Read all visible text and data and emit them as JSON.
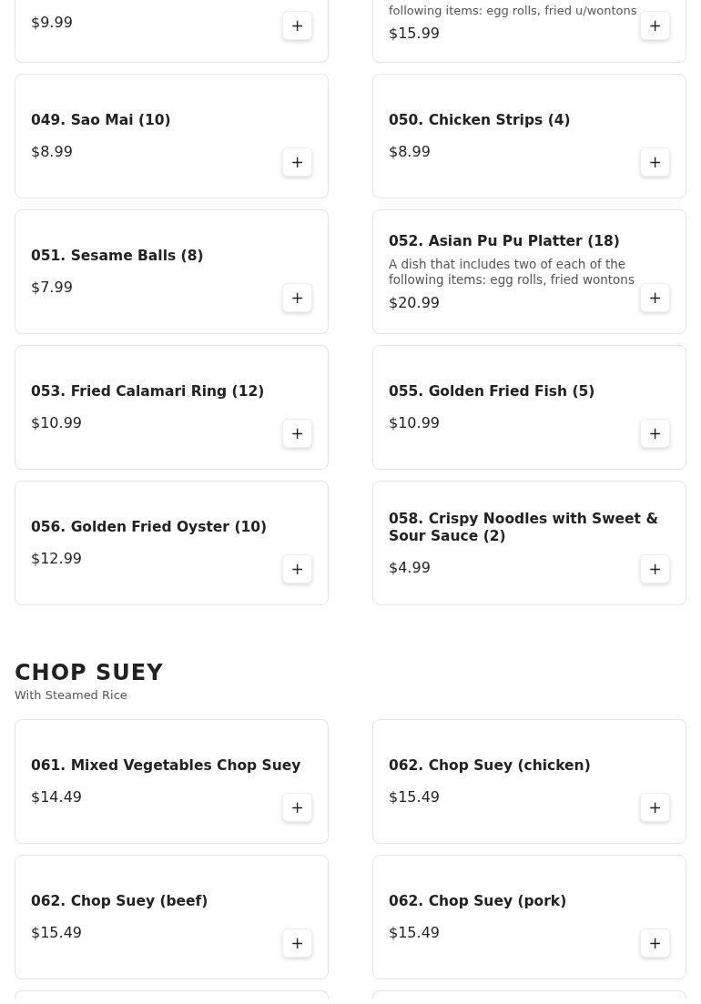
{
  "sections": [
    {
      "rows": [
        {
          "items": [
            {
              "kind": "cut-top",
              "price": "$9.99",
              "add_label": "+"
            },
            {
              "kind": "cut-top",
              "description": "following items: egg rolls, fried u/wontons",
              "price": "$15.99",
              "add_label": "+"
            }
          ]
        },
        {
          "items": [
            {
              "kind": "full",
              "name": "049. Sao Mai (10)",
              "price": "$8.99",
              "add_label": "+"
            },
            {
              "kind": "full",
              "name": "050. Chicken Strips (4)",
              "price": "$8.99",
              "add_label": "+"
            }
          ]
        },
        {
          "items": [
            {
              "kind": "full",
              "name": "051. Sesame Balls (8)",
              "price": "$7.99",
              "add_label": "+"
            },
            {
              "kind": "full",
              "name": "052. Asian Pu Pu Platter (18)",
              "description": "A dish that includes two of each of the following items: egg rolls, fried wontons",
              "price": "$20.99",
              "add_label": "+"
            }
          ]
        },
        {
          "items": [
            {
              "kind": "full",
              "name": "053. Fried Calamari Ring (12)",
              "price": "$10.99",
              "add_label": "+"
            },
            {
              "kind": "full",
              "name": "055. Golden Fried Fish (5)",
              "price": "$10.99",
              "add_label": "+"
            }
          ]
        },
        {
          "items": [
            {
              "kind": "full",
              "name": "056. Golden Fried Oyster (10)",
              "price": "$12.99",
              "add_label": "+"
            },
            {
              "kind": "full",
              "name": "058. Crispy Noodles with Sweet & Sour Sauce (2)",
              "price": "$4.99",
              "add_label": "+"
            }
          ]
        }
      ]
    },
    {
      "title": "CHOP SUEY",
      "subtitle": "With Steamed Rice",
      "rows": [
        {
          "items": [
            {
              "kind": "full",
              "name": "061. Mixed Vegetables Chop Suey",
              "price": "$14.49",
              "add_label": "+"
            },
            {
              "kind": "full",
              "name": "062. Chop Suey (chicken)",
              "price": "$15.49",
              "add_label": "+"
            }
          ]
        },
        {
          "items": [
            {
              "kind": "full",
              "name": "062. Chop Suey (beef)",
              "price": "$15.49",
              "add_label": "+"
            },
            {
              "kind": "full",
              "name": "062. Chop Suey (pork)",
              "price": "$15.49",
              "add_label": "+"
            }
          ]
        },
        {
          "items": [
            {
              "kind": "cut-bottom"
            },
            {
              "kind": "cut-bottom"
            }
          ]
        }
      ]
    }
  ]
}
